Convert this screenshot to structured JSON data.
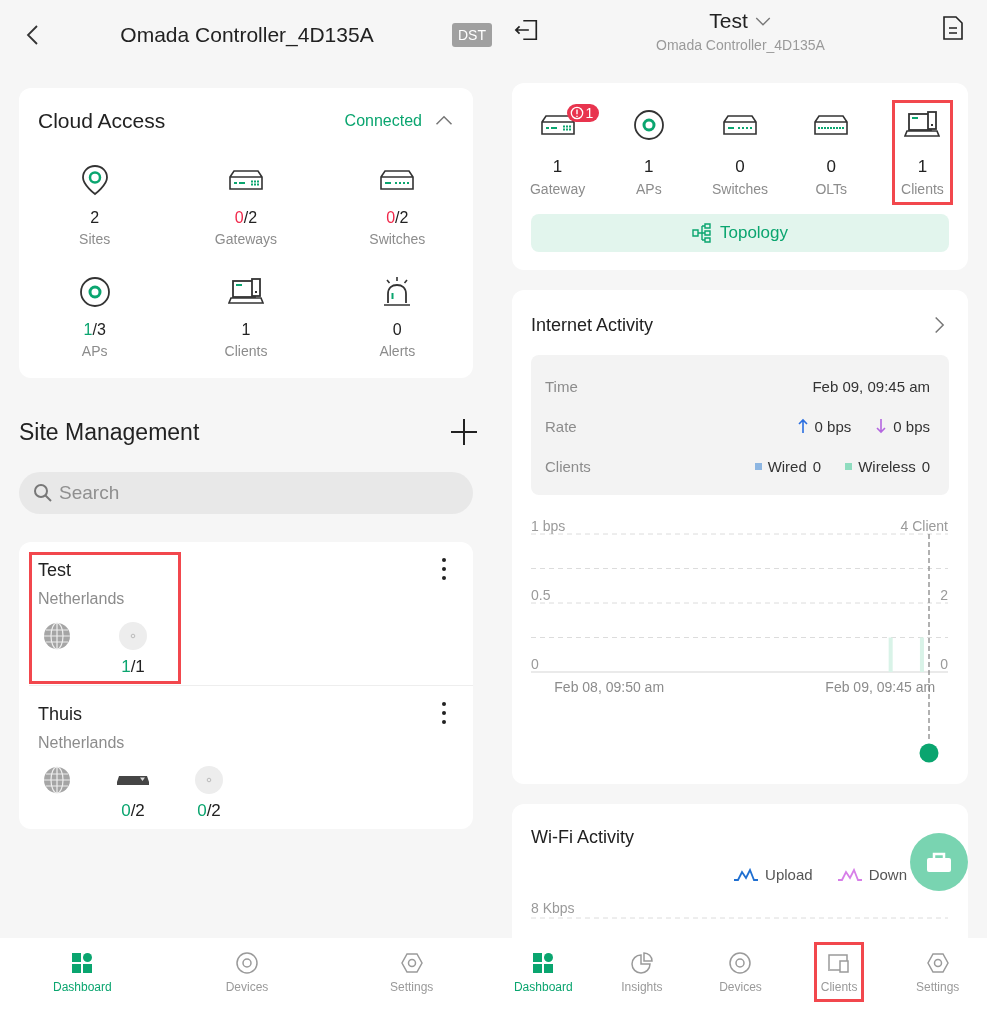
{
  "left_screen": {
    "header": {
      "title": "Omada Controller_4D135A",
      "badge": "DST"
    },
    "cloud_access": {
      "title": "Cloud Access",
      "status": "Connected",
      "expanded": true,
      "stats": [
        {
          "kind": "sites",
          "count": "2",
          "label": "Sites"
        },
        {
          "kind": "gateways",
          "count": "0",
          "total": "/2",
          "color": "#f0284a",
          "label": "Gateways"
        },
        {
          "kind": "switches",
          "count": "0",
          "total": "/2",
          "color": "#f0284a",
          "label": "Switches"
        },
        {
          "kind": "aps",
          "count": "1",
          "total": "/3",
          "color": "#0aa56f",
          "label": "APs"
        },
        {
          "kind": "clients",
          "count": "1",
          "label": "Clients"
        },
        {
          "kind": "alerts",
          "count": "0",
          "label": "Alerts"
        }
      ]
    },
    "site_management": {
      "title": "Site Management",
      "search": {
        "placeholder": "Search"
      },
      "sites": [
        {
          "name": "Test",
          "country": "Netherlands",
          "highlighted": true,
          "devices": [
            {
              "kind": "gateway"
            },
            {
              "kind": "ap",
              "count": "1",
              "total": "/1",
              "color": "#0aa56f"
            }
          ]
        },
        {
          "name": "Thuis",
          "country": "Netherlands",
          "highlighted": false,
          "devices": [
            {
              "kind": "gateway"
            },
            {
              "kind": "switch",
              "count": "0",
              "total": "/2",
              "color": "#0aa56f"
            },
            {
              "kind": "ap",
              "count": "0",
              "total": "/2",
              "color": "#0aa56f"
            }
          ]
        }
      ]
    },
    "nav": [
      {
        "kind": "dashboard",
        "label": "Dashboard",
        "selected": true
      },
      {
        "kind": "devices",
        "label": "Devices",
        "selected": false
      },
      {
        "kind": "settings",
        "label": "Settings",
        "selected": false
      }
    ]
  },
  "right_screen": {
    "header": {
      "title": "Test",
      "subtitle": "Omada Controller_4D135A"
    },
    "devices": [
      {
        "kind": "gateway",
        "count": "1",
        "label": "Gateway",
        "alert_count": "1",
        "highlighted": false
      },
      {
        "kind": "aps",
        "count": "1",
        "label": "APs",
        "highlighted": false
      },
      {
        "kind": "switches",
        "count": "0",
        "label": "Switches",
        "highlighted": false
      },
      {
        "kind": "olts",
        "count": "0",
        "label": "OLTs",
        "highlighted": false
      },
      {
        "kind": "clients",
        "count": "1",
        "label": "Clients",
        "highlighted": true
      }
    ],
    "topology_button": "Topology",
    "internet_activity": {
      "title": "Internet Activity",
      "rows": [
        {
          "kind": "time",
          "label": "Time",
          "value": "Feb 09, 09:45 am"
        },
        {
          "kind": "rate",
          "label": "Rate",
          "up": "0 bps",
          "down": "0 bps"
        },
        {
          "kind": "clients",
          "label": "Clients",
          "legend": [
            {
              "label": "Wired",
              "value": "0",
              "color": "#8db6e2"
            },
            {
              "label": "Wireless",
              "value": "0",
              "color": "#8fdcbf"
            }
          ]
        }
      ],
      "rate_axis_ticks": [
        "1 bps",
        "0.5",
        "0"
      ],
      "chart_data": {
        "type": "bar",
        "ylim": [
          0,
          4
        ],
        "categories": [
          null,
          null,
          null,
          null,
          null,
          null,
          null,
          "Feb 08, 09:50 am",
          null,
          null,
          null,
          null,
          null,
          null,
          null,
          null,
          null,
          null,
          null,
          null,
          null,
          null,
          null,
          null,
          null,
          null,
          null,
          null,
          null,
          null,
          null,
          null,
          null,
          "Feb 09, 09:45 am",
          null,
          null,
          null,
          null,
          null,
          null
        ],
        "series": [
          {
            "color": "#d9f3e8",
            "values": [
              null,
              null,
              null,
              null,
              null,
              null,
              null,
              null,
              null,
              null,
              null,
              null,
              null,
              null,
              null,
              null,
              null,
              null,
              null,
              null,
              null,
              null,
              null,
              null,
              null,
              null,
              null,
              null,
              null,
              null,
              null,
              null,
              null,
              null,
              1,
              null,
              null,
              1,
              null,
              null
            ]
          }
        ],
        "yticks": [
          {
            "value": 0,
            "label": "0"
          },
          {
            "value": 2,
            "label": "2"
          },
          {
            "value": 4,
            "label": "4 Client"
          }
        ]
      }
    },
    "wifi_activity": {
      "title": "Wi-Fi Activity",
      "legend": [
        {
          "label": "Upload",
          "color": "#1f6fd1"
        },
        {
          "label": "Down",
          "color": "#d77ee8"
        }
      ],
      "axis_label": "8 Kbps"
    },
    "nav": [
      {
        "kind": "dashboard",
        "label": "Dashboard",
        "selected": true,
        "highlighted": false
      },
      {
        "kind": "insights",
        "label": "Insights",
        "selected": false,
        "highlighted": false
      },
      {
        "kind": "devices",
        "label": "Devices",
        "selected": false,
        "highlighted": false
      },
      {
        "kind": "clients",
        "label": "Clients",
        "selected": false,
        "highlighted": true
      },
      {
        "kind": "settings",
        "label": "Settings",
        "selected": false,
        "highlighted": false
      }
    ]
  }
}
